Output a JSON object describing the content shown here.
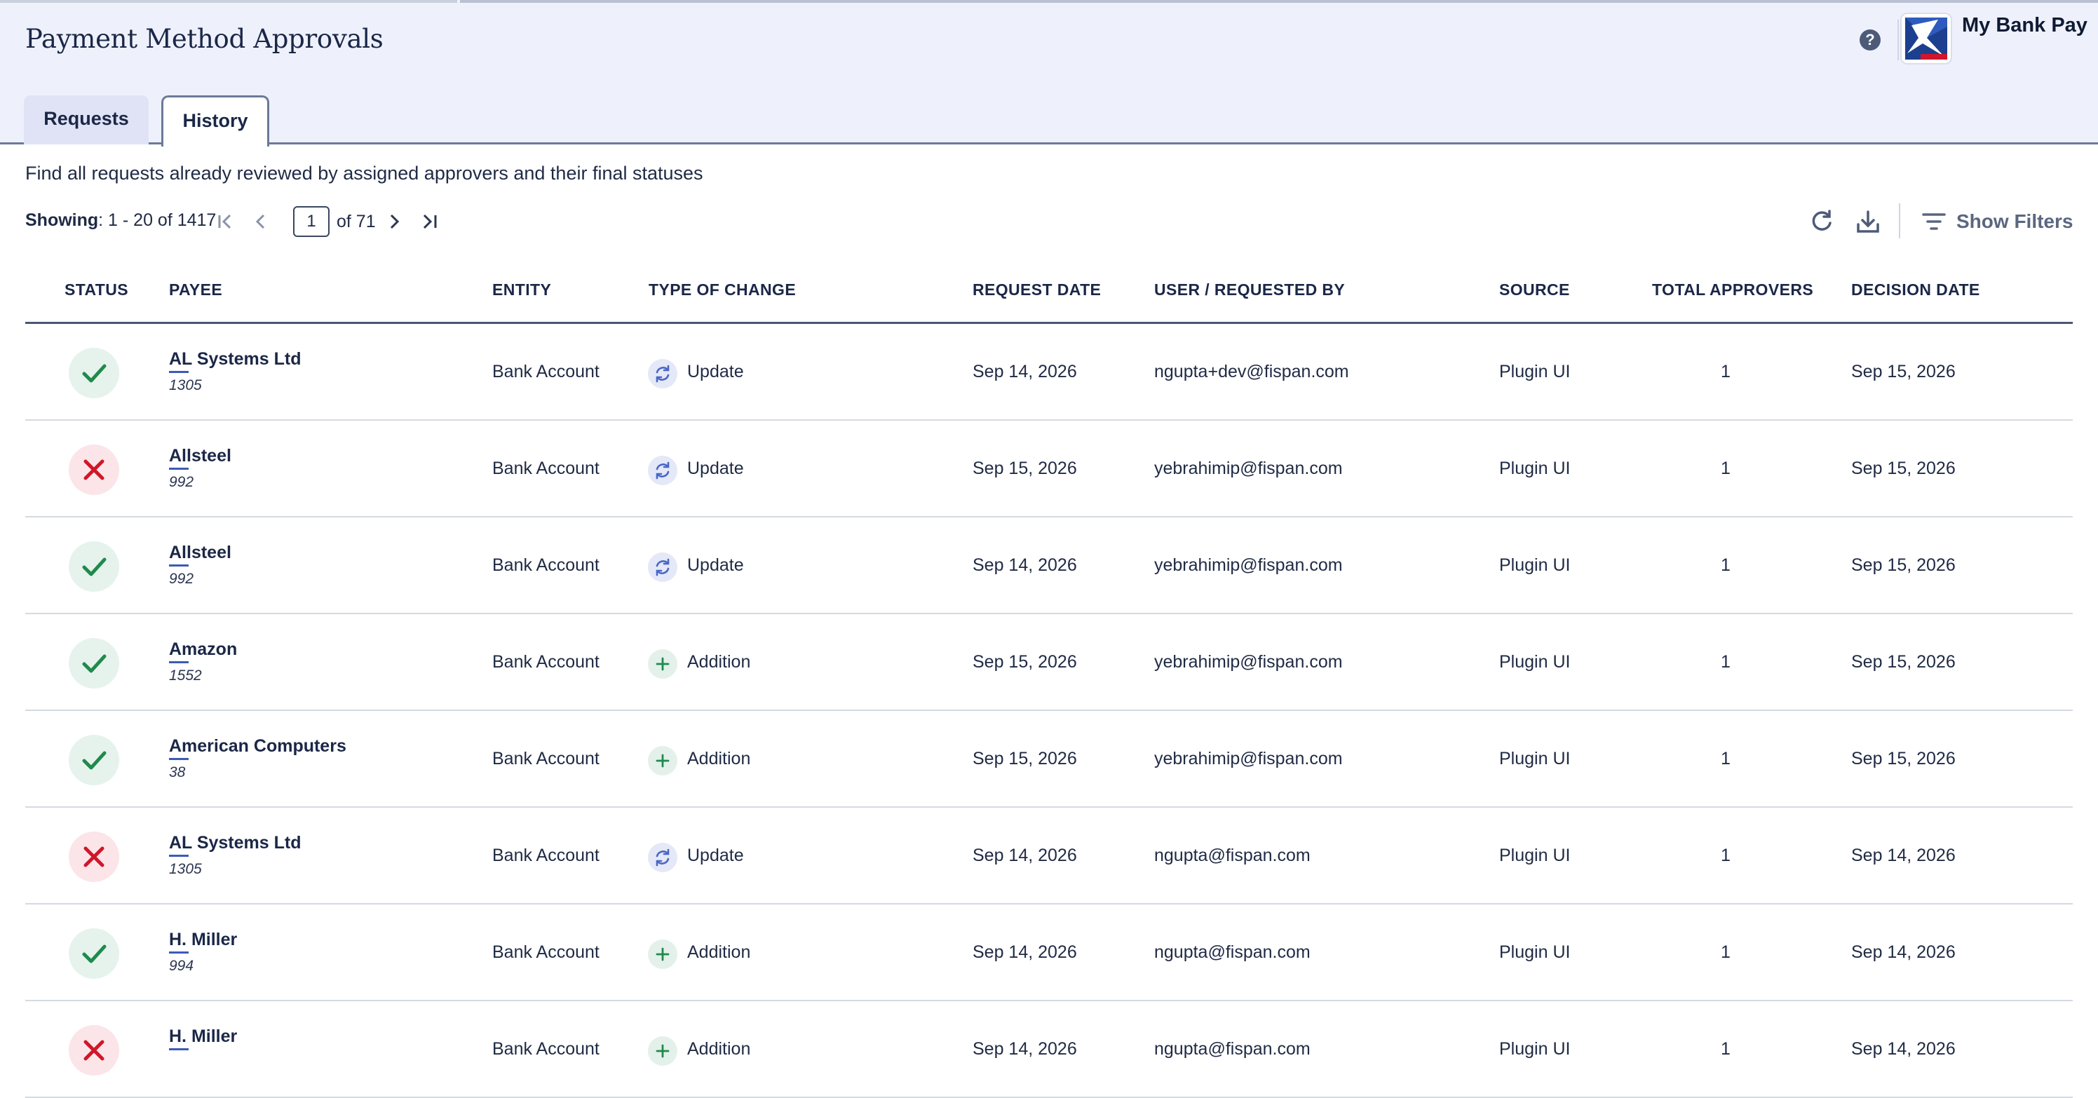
{
  "header": {
    "title": "Payment Method Approvals",
    "brand": "My Bank Pay"
  },
  "tabs": [
    {
      "label": "Requests",
      "active": false
    },
    {
      "label": "History",
      "active": true
    }
  ],
  "description": "Find all requests already reviewed by assigned approvers and their final statuses",
  "pagination": {
    "showing_label": "Showing",
    "showing_range": ": 1 - 20 of 1417",
    "current_page": "1",
    "of_label": "of 71"
  },
  "toolbar": {
    "filters_label": "Show Filters"
  },
  "columns": {
    "status": "STATUS",
    "payee": "PAYEE",
    "entity": "ENTITY",
    "type": "TYPE OF CHANGE",
    "request_date": "REQUEST DATE",
    "user": "USER / REQUESTED BY",
    "source": "SOURCE",
    "approvers": "TOTAL APPROVERS",
    "decision_date": "DECISION DATE"
  },
  "colors": {
    "approved": "#1f8a4c",
    "rejected": "#d0162b",
    "accent": "#3b5bb5"
  },
  "rows": [
    {
      "status": "approved",
      "payee": "AL Systems Ltd",
      "payee_id": "1305",
      "entity": "Bank Account",
      "type": "Update",
      "request_date": "Sep 14, 2026",
      "user": "ngupta+dev@fispan.com",
      "source": "Plugin UI",
      "approvers": "1",
      "decision_date": "Sep 15, 2026"
    },
    {
      "status": "rejected",
      "payee": "Allsteel",
      "payee_id": "992",
      "entity": "Bank Account",
      "type": "Update",
      "request_date": "Sep 15, 2026",
      "user": "yebrahimip@fispan.com",
      "source": "Plugin UI",
      "approvers": "1",
      "decision_date": "Sep 15, 2026"
    },
    {
      "status": "approved",
      "payee": "Allsteel",
      "payee_id": "992",
      "entity": "Bank Account",
      "type": "Update",
      "request_date": "Sep 14, 2026",
      "user": "yebrahimip@fispan.com",
      "source": "Plugin UI",
      "approvers": "1",
      "decision_date": "Sep 15, 2026"
    },
    {
      "status": "approved",
      "payee": "Amazon",
      "payee_id": "1552",
      "entity": "Bank Account",
      "type": "Addition",
      "request_date": "Sep 15, 2026",
      "user": "yebrahimip@fispan.com",
      "source": "Plugin UI",
      "approvers": "1",
      "decision_date": "Sep 15, 2026"
    },
    {
      "status": "approved",
      "payee": "American Computers",
      "payee_id": "38",
      "entity": "Bank Account",
      "type": "Addition",
      "request_date": "Sep 15, 2026",
      "user": "yebrahimip@fispan.com",
      "source": "Plugin UI",
      "approvers": "1",
      "decision_date": "Sep 15, 2026"
    },
    {
      "status": "rejected",
      "payee": "AL Systems Ltd",
      "payee_id": "1305",
      "entity": "Bank Account",
      "type": "Update",
      "request_date": "Sep 14, 2026",
      "user": "ngupta@fispan.com",
      "source": "Plugin UI",
      "approvers": "1",
      "decision_date": "Sep 14, 2026"
    },
    {
      "status": "approved",
      "payee": "H. Miller",
      "payee_id": "994",
      "entity": "Bank Account",
      "type": "Addition",
      "request_date": "Sep 14, 2026",
      "user": "ngupta@fispan.com",
      "source": "Plugin UI",
      "approvers": "1",
      "decision_date": "Sep 14, 2026"
    },
    {
      "status": "rejected",
      "payee": "H. Miller",
      "payee_id": "",
      "entity": "Bank Account",
      "type": "Addition",
      "request_date": "Sep 14, 2026",
      "user": "ngupta@fispan.com",
      "source": "Plugin UI",
      "approvers": "1",
      "decision_date": "Sep 14, 2026"
    }
  ]
}
